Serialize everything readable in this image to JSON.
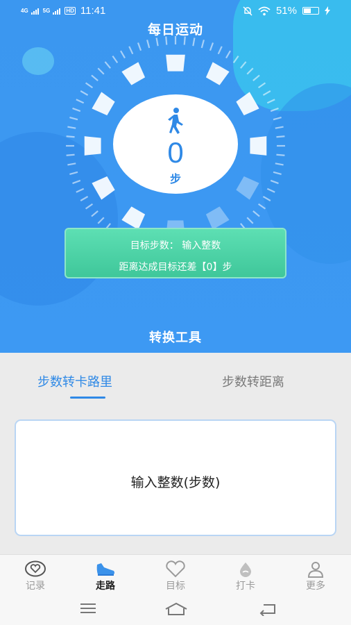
{
  "status_bar": {
    "signal_1": "4G",
    "signal_2": "5G",
    "hd": "HD",
    "time": "11:41",
    "battery": "51%",
    "battery_level": 0.51
  },
  "header": {
    "title": "每日运动"
  },
  "pedometer": {
    "steps": "0",
    "unit": "步"
  },
  "goal": {
    "label": "目标步数：",
    "placeholder": "输入整数",
    "remaining_text": "距离达成目标还差【0】步"
  },
  "tools": {
    "title": "转换工具"
  },
  "tabs": [
    {
      "label": "步数转卡路里",
      "active": true
    },
    {
      "label": "步数转距离",
      "active": false
    }
  ],
  "converter": {
    "input_placeholder": "输入整数(步数)"
  },
  "bottom_nav": [
    {
      "label": "记录",
      "icon": "heart-chat-icon"
    },
    {
      "label": "走路",
      "icon": "shoe-icon",
      "active": true
    },
    {
      "label": "目标",
      "icon": "heart-icon"
    },
    {
      "label": "打卡",
      "icon": "drop-icon"
    },
    {
      "label": "更多",
      "icon": "person-icon"
    }
  ],
  "colors": {
    "primary": "#2f89e6",
    "hero_bg": "#3b97f0",
    "goal_card": "#4fd3a6"
  }
}
